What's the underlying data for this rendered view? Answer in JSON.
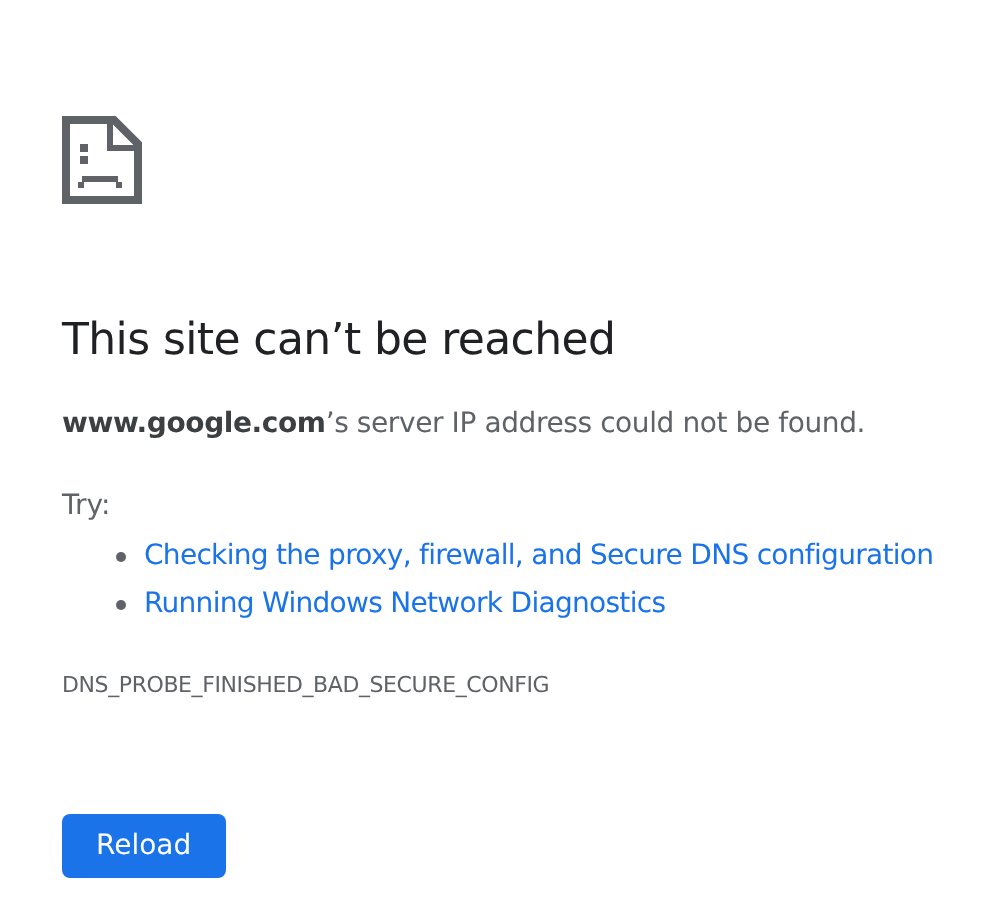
{
  "heading": "This site can’t be reached",
  "summary": "**www.google.com**’s server IP address could not be found.",
  "try_label": "Try:",
  "suggestions": [
    {
      "text": "Checking the proxy, firewall, and Secure DNS configuration"
    },
    {
      "text": "Running Windows Network Diagnostics"
    }
  ],
  "error_code": "DNS_PROBE_FINISHED_BAD_SECURE_CONFIG",
  "buttons": [
    {
      "label": "Reload"
    }
  ]
}
